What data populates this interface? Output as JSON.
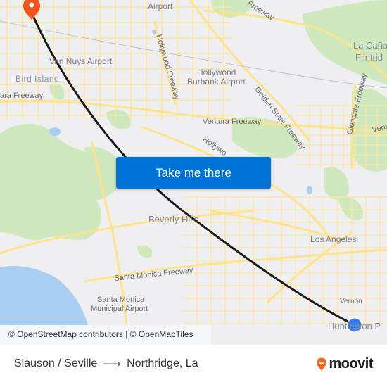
{
  "map": {
    "labels": {
      "airport_top": "Airport",
      "van_nuys_airport": "Van Nuys Airport",
      "bird_island": "Bird Island",
      "ventura_freeway_left": "ara Freeway",
      "hollywood_freeway": "Hollywood Freeway",
      "hollywood_burbank_airport_1": "Hollywood",
      "hollywood_burbank_airport_2": "Burbank Airport",
      "golden_state_freeway": "Golden State Freeway",
      "freeway_top": "Freeway",
      "la_canada_1": "La Caña",
      "la_canada_2": "Flintrid",
      "glendale_freeway": "Glendale Freeway",
      "ventura_right": "Ventu",
      "ventura_freeway_mid": "Ventura Freeway",
      "hollywood_mid": "Hollywo",
      "beverly_hills": "Beverly Hills",
      "santa_monica_freeway": "Santa Monica Freeway",
      "santa_monica_airport_1": "Santa Monica",
      "santa_monica_airport_2": "Municipal Airport",
      "los_angeles": "Los Angeles",
      "vernon": "Vernon",
      "huntington_park": "Huntington P"
    },
    "origin_marker": {
      "name": "Slauson / Seville",
      "color": "#2f7ef5"
    },
    "destination_marker": {
      "name": "Northridge, La",
      "color": "#f2541b"
    },
    "route_color": "#1a1a1a",
    "water_color": "#a6cdf3",
    "park_color": "#c8e6b4",
    "road_color": "#fde99a"
  },
  "attribution": "© OpenStreetMap contributors | © OpenMapTiles",
  "cta": {
    "label": "Take me there",
    "color": "#0073d6"
  },
  "footer": {
    "from": "Slauson / Seville",
    "arrow": "⟶",
    "to": "Northridge, La",
    "brand": "moovit",
    "brand_color": "#f26b21"
  }
}
